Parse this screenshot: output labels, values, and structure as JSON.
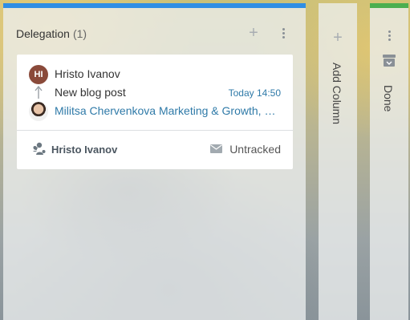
{
  "columns": [
    {
      "title": "Delegation",
      "count": "(1)",
      "accent_color": "#2f8ee5",
      "cards": [
        {
          "author": {
            "name": "Hristo Ivanov",
            "initials": "HI"
          },
          "task_title": "New blog post",
          "date": "Today 14:50",
          "assignee": "Militsa Chervenkova Marketing & Growth, Marketing",
          "footer": {
            "owner": "Hristo Ivanov",
            "tracking": "Untracked"
          }
        }
      ]
    }
  ],
  "add_column": {
    "label": "Add Column"
  },
  "done_column": {
    "label": "Done",
    "accent_color": "#4caf50"
  },
  "icons": {
    "plus": "plus-icon",
    "more": "vertical-dots-icon",
    "arrow": "arrow-up-icon",
    "team": "team-icon",
    "mail": "mail-icon",
    "archive": "archive-icon"
  },
  "symbols": {
    "plus": "+"
  }
}
